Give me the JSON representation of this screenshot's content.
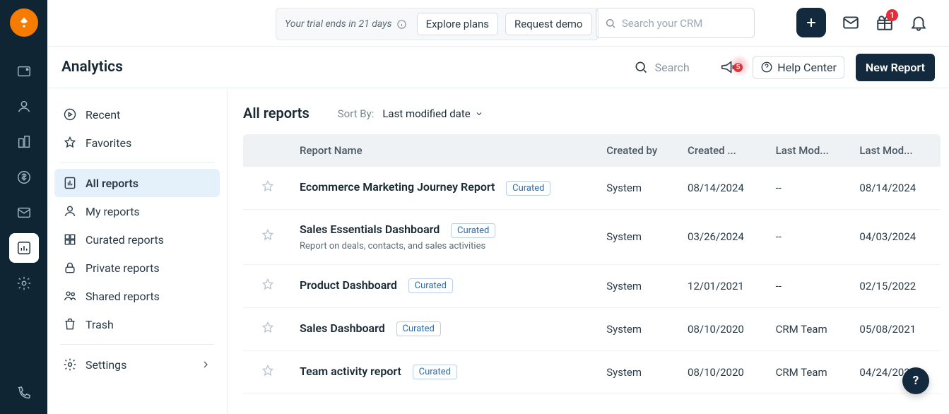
{
  "top": {
    "trial_text": "Your trial ends in 21 days",
    "explore": "Explore plans",
    "request_demo": "Request demo",
    "search_placeholder": "Search your CRM",
    "gift_badge": "1"
  },
  "page": {
    "title": "Analytics",
    "search_placeholder": "Search",
    "megaphone_count": "5",
    "help_center": "Help Center",
    "new_report": "New Report"
  },
  "sidebar": {
    "recent": "Recent",
    "favorites": "Favorites",
    "all": "All reports",
    "my": "My reports",
    "curated": "Curated reports",
    "private": "Private reports",
    "shared": "Shared reports",
    "trash": "Trash",
    "settings": "Settings"
  },
  "main": {
    "heading": "All reports",
    "sort_label": "Sort By:",
    "sort_value": "Last modified date"
  },
  "columns": {
    "name": "Report Name",
    "created_by": "Created by",
    "created_on": "Created ...",
    "modified_by": "Last Mod...",
    "modified_on": "Last Mod..."
  },
  "rows": [
    {
      "name": "Ecommerce Marketing Journey Report",
      "desc": "",
      "tag": "Curated",
      "created_by": "System",
      "created_on": "08/14/2024",
      "modified_by": "--",
      "modified_on": "08/14/2024"
    },
    {
      "name": "Sales Essentials Dashboard",
      "desc": "Report on deals, contacts, and sales activities",
      "tag": "Curated",
      "created_by": "System",
      "created_on": "03/26/2024",
      "modified_by": "--",
      "modified_on": "04/03/2024"
    },
    {
      "name": "Product Dashboard",
      "desc": "",
      "tag": "Curated",
      "created_by": "System",
      "created_on": "12/01/2021",
      "modified_by": "--",
      "modified_on": "02/15/2022"
    },
    {
      "name": "Sales Dashboard",
      "desc": "",
      "tag": "Curated",
      "created_by": "System",
      "created_on": "08/10/2020",
      "modified_by": "CRM Team",
      "modified_on": "05/08/2021"
    },
    {
      "name": "Team activity report",
      "desc": "",
      "tag": "Curated",
      "created_by": "System",
      "created_on": "08/10/2020",
      "modified_by": "CRM Team",
      "modified_on": "04/24/2021"
    }
  ],
  "fab": "?"
}
